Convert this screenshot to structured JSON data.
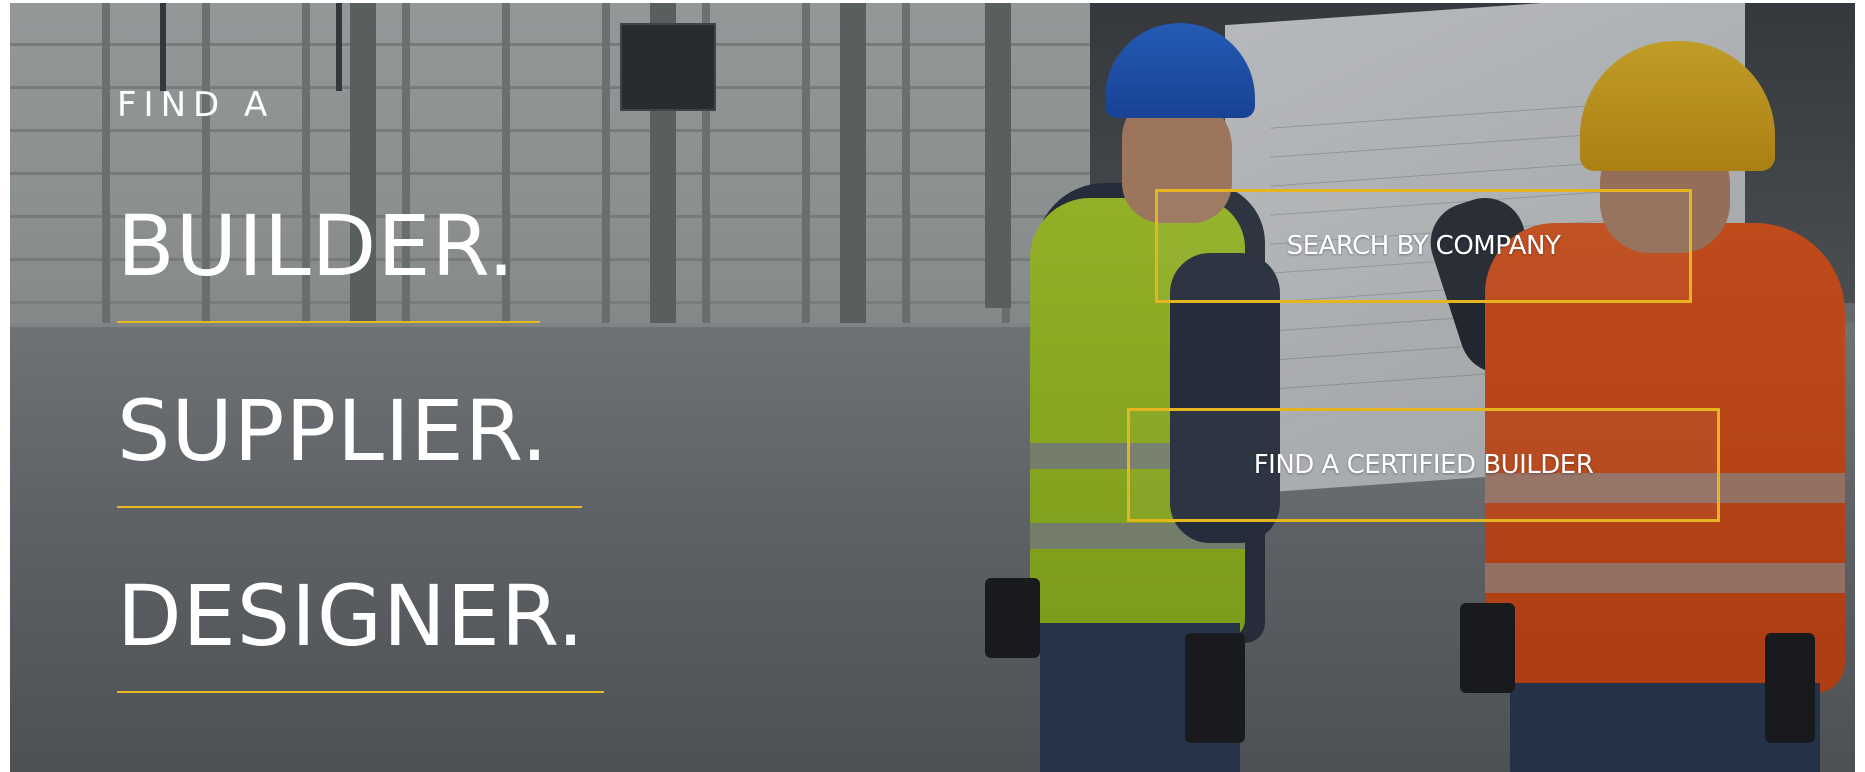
{
  "hero": {
    "eyebrow": "FIND A",
    "words": [
      "BUILDER.",
      "SUPPLIER.",
      "DESIGNER."
    ],
    "accent_color": "#e6b91e"
  },
  "actions": {
    "search_by_company": "SEARCH BY COMPANY",
    "find_certified_builder": "FIND A CERTIFIED BUILDER"
  }
}
